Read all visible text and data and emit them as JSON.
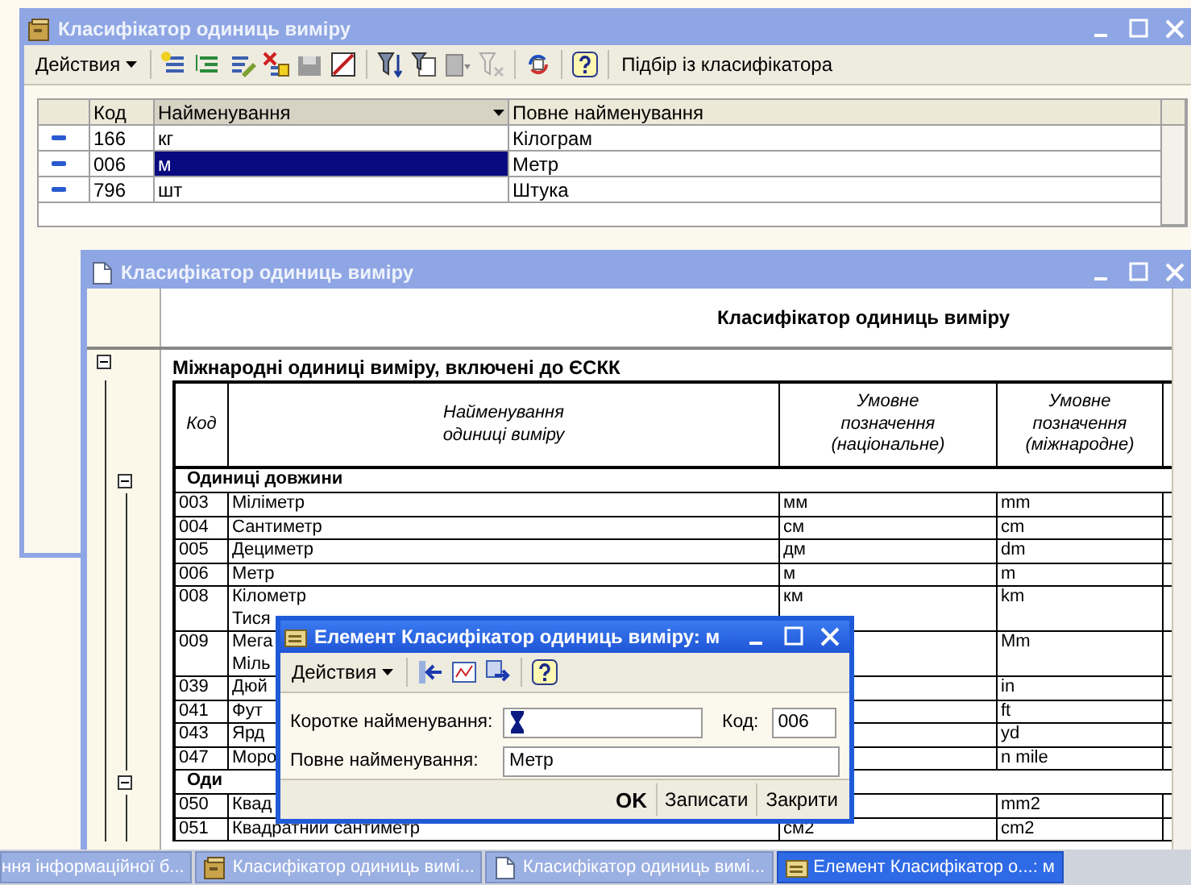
{
  "list_window": {
    "title": "Класифікатор одиниць виміру",
    "active": false,
    "actions_menu": "Действия",
    "pick_button": "Підбір із класифікатора",
    "columns": [
      {
        "label": "Код",
        "sorted": false
      },
      {
        "label": "Найменування",
        "sorted": true
      },
      {
        "label": "Повне найменування",
        "sorted": false
      }
    ],
    "rows": [
      {
        "code": "166",
        "name": "кг",
        "full_name": "Кілограм",
        "selected": false
      },
      {
        "code": "006",
        "name": "м",
        "full_name": "Метр",
        "selected": true
      },
      {
        "code": "796",
        "name": "шт",
        "full_name": "Штука",
        "selected": false
      }
    ]
  },
  "report_window": {
    "title": "Класифікатор одиниць виміру",
    "active": false,
    "report": {
      "title": "Класифікатор одиниць виміру",
      "group": {
        "title": "Міжнародні одиниці виміру, включені до ЄСКК",
        "expanded": true
      },
      "columns": [
        [
          "Код"
        ],
        [
          "Найменування",
          "одиниці виміру"
        ],
        [
          "Умовне",
          "позначення",
          "(національне)"
        ],
        [
          "Умовне",
          "позначення",
          "(міжнародне)"
        ]
      ],
      "sections": [
        {
          "title": "Одиниці довжини",
          "expanded": true,
          "rows": [
            {
              "code": "003",
              "name": [
                "Міліметр"
              ],
              "national": "мм",
              "international": "mm"
            },
            {
              "code": "004",
              "name": [
                "Сантиметр"
              ],
              "national": "см",
              "international": "cm"
            },
            {
              "code": "005",
              "name": [
                "Дециметр"
              ],
              "national": "дм",
              "international": "dm"
            },
            {
              "code": "006",
              "name": [
                "Метр"
              ],
              "national": "м",
              "international": "m"
            },
            {
              "code": "008",
              "name": [
                "Кілометр",
                "Тися"
              ],
              "national": "км",
              "international": "km"
            },
            {
              "code": "009",
              "name": [
                "Мега",
                "Міль"
              ],
              "international": "Mm"
            },
            {
              "code": "039",
              "name": [
                "Дюй"
              ],
              "international": "in"
            },
            {
              "code": "041",
              "name": [
                "Фут"
              ],
              "international": "ft"
            },
            {
              "code": "043",
              "name": [
                "Ярд"
              ],
              "international": "yd"
            },
            {
              "code": "047",
              "name": [
                "Моро"
              ],
              "international": "n mile"
            }
          ]
        },
        {
          "title": "Оди",
          "expanded": true,
          "rows": [
            {
              "code": "050",
              "name": [
                "Квад"
              ],
              "international": "mm2"
            },
            {
              "code": "051",
              "name": [
                "Квадратний сантиметр"
              ],
              "national": "см2",
              "international": "cm2"
            }
          ]
        }
      ]
    }
  },
  "dialog": {
    "title": "Елемент Класифікатор одиниць виміру: м",
    "active": true,
    "actions_menu": "Действия",
    "short_name": {
      "label": "Коротке найменування:"
    },
    "code": {
      "label": "Код:",
      "value": "006"
    },
    "full_name": {
      "label": "Повне найменування:",
      "value": "Метр"
    },
    "buttons": [
      {
        "label": "OK",
        "default": true
      },
      {
        "label": "Записати",
        "default": false
      },
      {
        "label": "Закрити",
        "default": false
      }
    ]
  },
  "taskbar": [
    {
      "label": "ння інформаційної б...",
      "kind": "none",
      "selected": false
    },
    {
      "label": "Класифікатор одиниць вимі...",
      "kind": "catalog",
      "selected": false
    },
    {
      "label": "Класифікатор одиниць вимі...",
      "kind": "document",
      "selected": false
    },
    {
      "label": "Елемент Класифікатор о...: м",
      "kind": "form",
      "selected": true
    }
  ]
}
